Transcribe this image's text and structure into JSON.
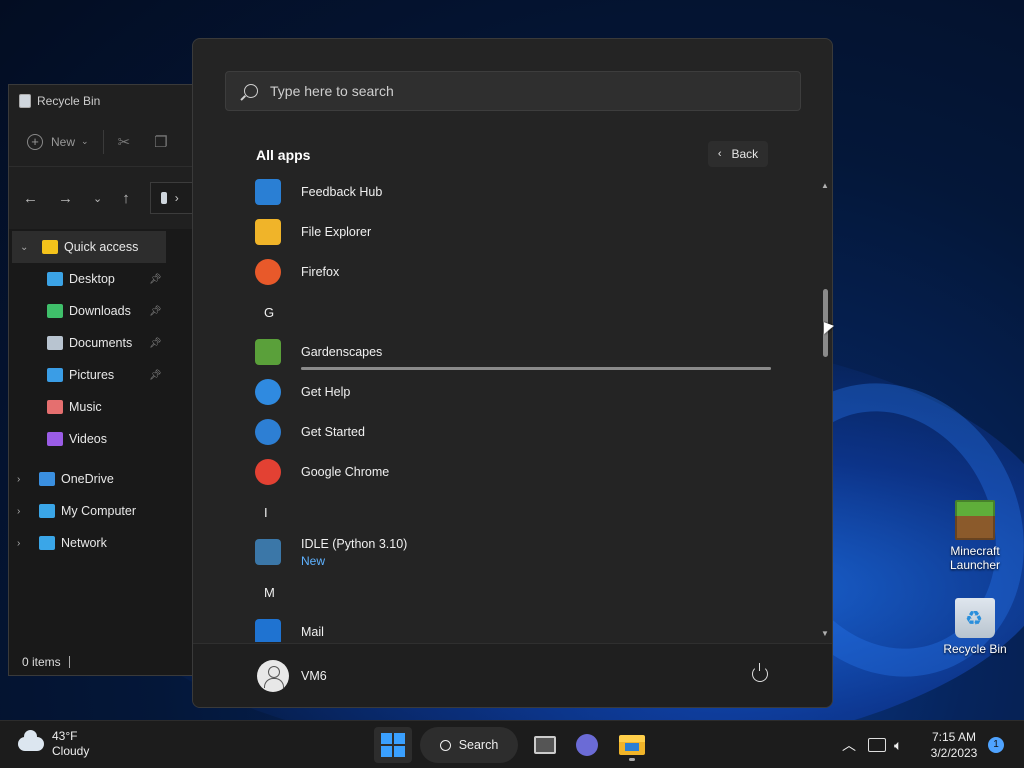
{
  "explorer": {
    "title": "Recycle Bin",
    "toolbar": {
      "new_label": "New"
    },
    "tree": [
      {
        "label": "Quick access",
        "icon": "star-icon",
        "selected": true,
        "pinned": false,
        "chevron": "⌄",
        "color": "#f4c31b"
      },
      {
        "label": "Desktop",
        "icon": "desktop-icon",
        "pinned": true,
        "color": "#3ba3e6"
      },
      {
        "label": "Downloads",
        "icon": "download-icon",
        "pinned": true,
        "color": "#3fbf6a"
      },
      {
        "label": "Documents",
        "icon": "document-icon",
        "pinned": true,
        "color": "#b8c4d0"
      },
      {
        "label": "Pictures",
        "icon": "pictures-icon",
        "pinned": true,
        "color": "#3a9de6"
      },
      {
        "label": "Music",
        "icon": "music-icon",
        "pinned": false,
        "color": "#e56f6f"
      },
      {
        "label": "Videos",
        "icon": "videos-icon",
        "pinned": false,
        "color": "#9a5ce6"
      },
      {
        "label": "OneDrive",
        "icon": "cloud-icon",
        "chevron": "›",
        "color": "#3a8fe0"
      },
      {
        "label": "My Computer",
        "icon": "computer-icon",
        "chevron": "›",
        "color": "#3aa6e8"
      },
      {
        "label": "Network",
        "icon": "network-icon",
        "chevron": "›",
        "color": "#3aa6e8"
      }
    ],
    "status": "0 items"
  },
  "start_menu": {
    "search_placeholder": "Type here to search",
    "all_apps_title": "All apps",
    "back_label": "Back",
    "apps": [
      {
        "kind": "app",
        "name": "Feedback Hub",
        "icon": "feedback-hub-icon",
        "color": "#2a7fd4"
      },
      {
        "kind": "app",
        "name": "File Explorer",
        "icon": "file-explorer-icon",
        "color": "#f0b429"
      },
      {
        "kind": "app",
        "name": "Firefox",
        "icon": "firefox-icon",
        "color": "#e8592a"
      },
      {
        "kind": "letter",
        "name": "G"
      },
      {
        "kind": "app",
        "name": "Gardenscapes",
        "icon": "gardenscapes-icon",
        "color": "#5aa03a",
        "progress": 1.0
      },
      {
        "kind": "app",
        "name": "Get Help",
        "icon": "get-help-icon",
        "color": "#2f8ae0"
      },
      {
        "kind": "app",
        "name": "Get Started",
        "icon": "get-started-icon",
        "color": "#2d7fd4"
      },
      {
        "kind": "app",
        "name": "Google Chrome",
        "icon": "chrome-icon",
        "color": "#e34133"
      },
      {
        "kind": "letter",
        "name": "I"
      },
      {
        "kind": "app",
        "name": "IDLE (Python 3.10)",
        "sub": "New",
        "icon": "python-icon",
        "color": "#3b77a8"
      },
      {
        "kind": "letter",
        "name": "M"
      },
      {
        "kind": "app",
        "name": "Mail",
        "icon": "mail-icon",
        "color": "#1f73d1"
      }
    ],
    "user": "VM6"
  },
  "desktop_icons": [
    {
      "label": "Minecraft\nLauncher",
      "icon": "minecraft-icon"
    },
    {
      "label": "Recycle Bin",
      "icon": "recycle-bin-icon"
    }
  ],
  "taskbar": {
    "weather_temp": "43°F",
    "weather_desc": "Cloudy",
    "search_label": "Search",
    "time": "7:15 AM",
    "date": "3/2/2023",
    "notifications": "1"
  }
}
